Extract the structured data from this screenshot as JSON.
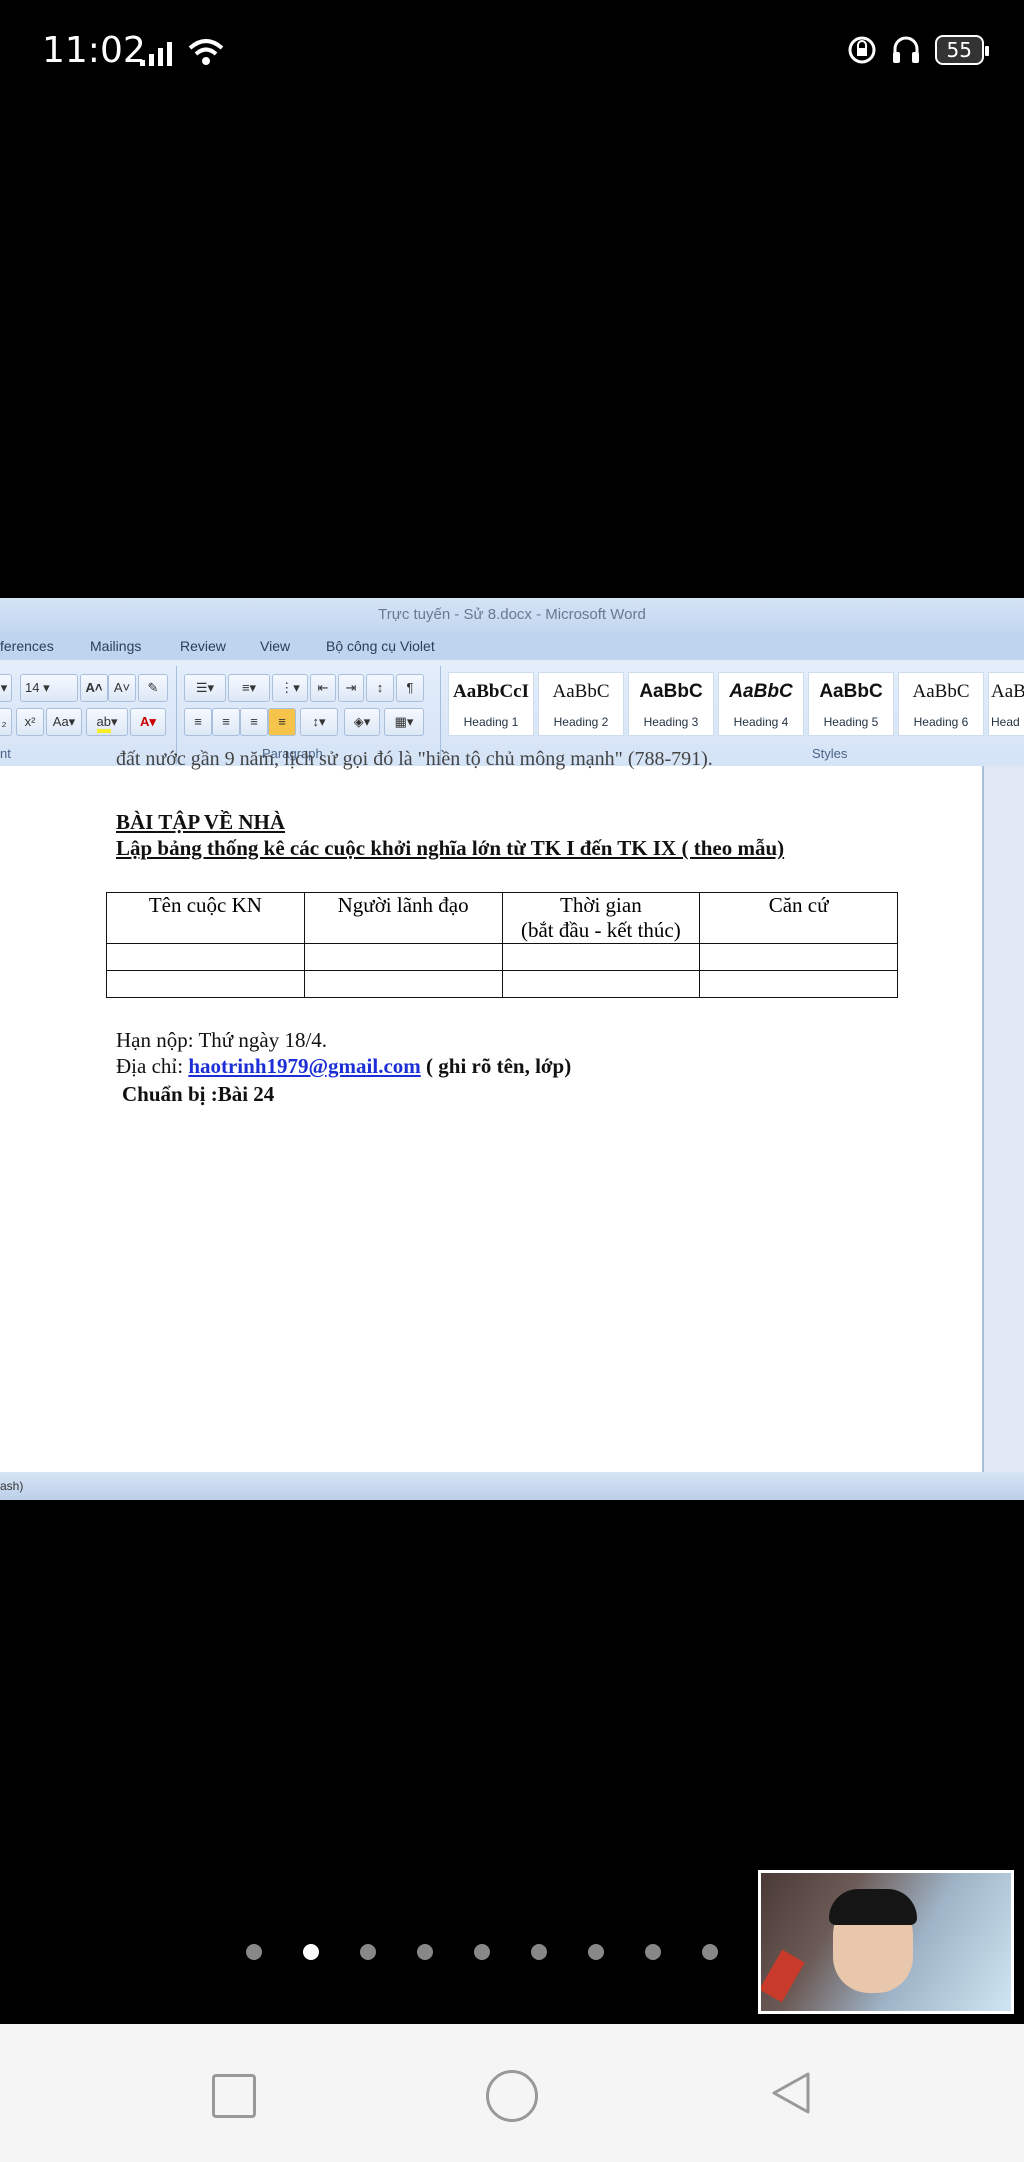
{
  "status_bar": {
    "time": "11:02",
    "battery": "55"
  },
  "word": {
    "title": "Trực tuyến - Sử 8.docx - Microsoft Word",
    "tabs": [
      "ferences",
      "Mailings",
      "Review",
      "View",
      "Bộ công cụ Violet"
    ],
    "font_size": "14",
    "groups": {
      "font": "nt",
      "paragraph": "Paragraph",
      "styles": "Styles"
    },
    "styles": [
      {
        "sample": "AaBbCcI",
        "name": "Heading 1"
      },
      {
        "sample": "AaBbC",
        "name": "Heading 2"
      },
      {
        "sample": "AaBbC",
        "name": "Heading 3"
      },
      {
        "sample": "AaBbC",
        "name": "Heading 4"
      },
      {
        "sample": "AaBbC",
        "name": "Heading 5"
      },
      {
        "sample": "AaBbC",
        "name": "Heading 6"
      },
      {
        "sample": "AaB",
        "name": "Head"
      }
    ],
    "status_text": "ash)"
  },
  "document": {
    "cut_line": "đất nước gần 9 năm, lịch sử gọi đó là \"hiền tộ chủ mông mạnh\" (788-791).",
    "homework_title": "BÀI TẬP VỀ NHÀ",
    "task": "Lập bảng thống kê các cuộc khởi nghĩa lớn từ TK I đến TK IX ( theo mẫu)",
    "table_headers": [
      "Tên cuộc KN",
      "Người lãnh đạo",
      "Thời gian",
      "Căn cứ"
    ],
    "time_sub": "(bắt đầu - kết thúc)",
    "deadline": "Hạn nộp: Thứ  ngày 18/4.",
    "address_label": "Địa chỉ: ",
    "email": "haotrinh1979@gmail.com",
    "address_note": " ( ghi rõ tên, lớp)",
    "prepare": "Chuẩn bị :Bài 24"
  },
  "pager": {
    "count": 9,
    "active_index": 1
  }
}
